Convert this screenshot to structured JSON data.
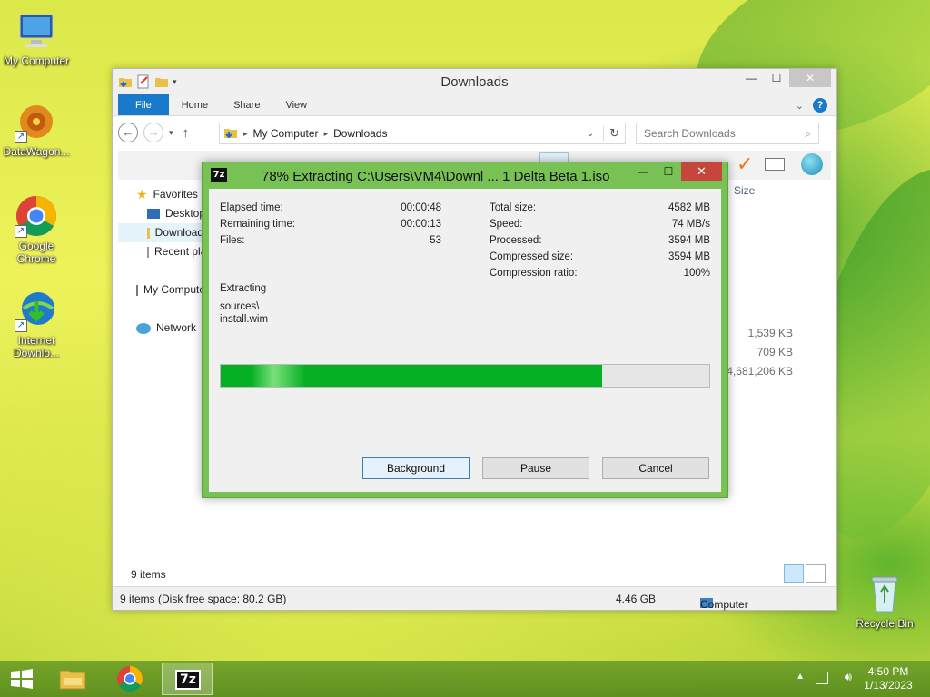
{
  "desktop": {
    "icons": [
      {
        "label": "My Computer",
        "icon": "computer-icon"
      },
      {
        "label": "DataWagon...",
        "icon": "datawagon-icon"
      },
      {
        "label": "Google Chrome",
        "icon": "chrome-icon"
      },
      {
        "label": "Internet Downlo...",
        "icon": "internet-download-manager-icon"
      },
      {
        "label": "Recycle Bin",
        "icon": "recycle-bin-icon"
      }
    ]
  },
  "explorer": {
    "title": "Downloads",
    "tabs": {
      "file": "File",
      "home": "Home",
      "share": "Share",
      "view": "View"
    },
    "address": {
      "root": "My Computer",
      "current": "Downloads"
    },
    "search_placeholder": "Search Downloads",
    "nav": {
      "favorites": "Favorites",
      "desktop": "Desktop",
      "downloads": "Downloads",
      "recent": "Recent places",
      "my_computer": "My Computer",
      "network": "Network"
    },
    "size_header": "Size",
    "sizes": [
      "1,539 KB",
      "709 KB",
      "4,681,206 KB"
    ],
    "items_count": "9 items",
    "status": {
      "left": "9 items (Disk free space: 80.2 GB)",
      "size": "4.46 GB",
      "location": "Computer"
    }
  },
  "zip_dialog": {
    "title": "78% Extracting C:\\Users\\VM4\\Downl ... 1 Delta Beta 1.iso",
    "logo": "7z",
    "left_stats": [
      {
        "label": "Elapsed time:",
        "value": "00:00:48"
      },
      {
        "label": "Remaining time:",
        "value": "00:00:13"
      },
      {
        "label": "Files:",
        "value": "53"
      }
    ],
    "right_stats": [
      {
        "label": "Total size:",
        "value": "4582 MB"
      },
      {
        "label": "Speed:",
        "value": "74 MB/s"
      },
      {
        "label": "Processed:",
        "value": "3594 MB"
      },
      {
        "label": "Compressed size:",
        "value": "3594 MB"
      },
      {
        "label": "Compression ratio:",
        "value": "100%"
      }
    ],
    "action": "Extracting",
    "current_dir": "sources\\",
    "current_file": "install.wim",
    "progress": 0.78,
    "buttons": {
      "background": "Background",
      "pause": "Pause",
      "cancel": "Cancel"
    }
  },
  "taskbar": {
    "time": "4:50 PM",
    "date": "1/13/2023"
  }
}
